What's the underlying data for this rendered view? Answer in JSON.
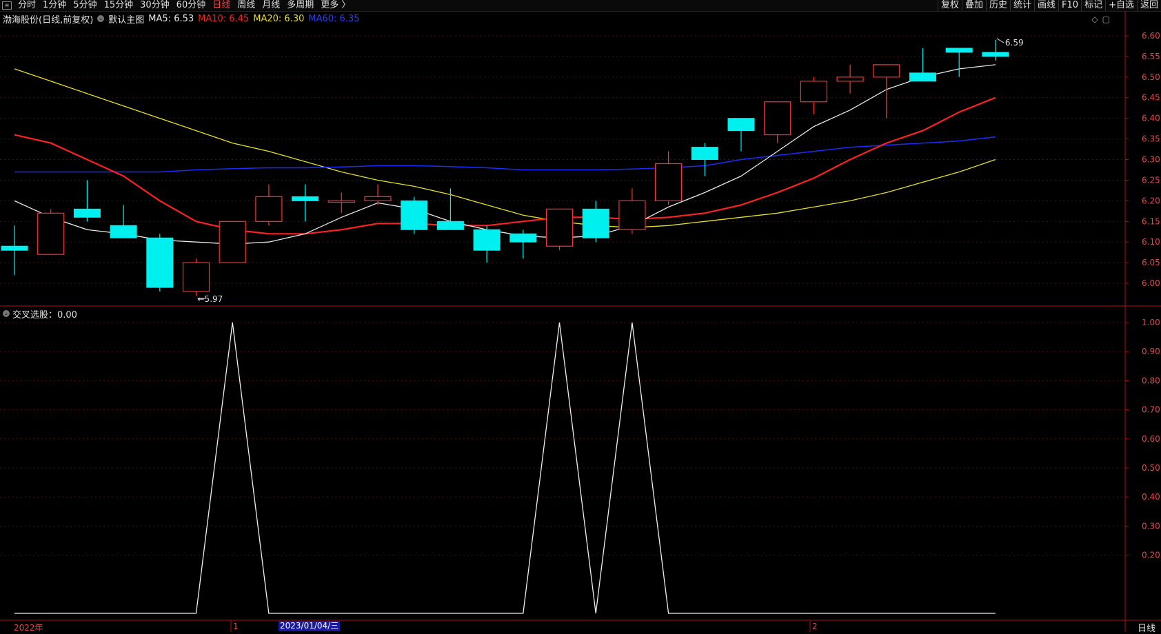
{
  "toolbar": {
    "left_items": [
      "分时",
      "1分钟",
      "5分钟",
      "15分钟",
      "30分钟",
      "60分钟",
      "日线",
      "周线",
      "月线",
      "多周期",
      "更多 〉"
    ],
    "active_item": "日线",
    "right_items": [
      "复权",
      "叠加",
      "历史",
      "统计",
      "画线",
      "F10",
      "标记",
      "+自选",
      "返回"
    ]
  },
  "main_legend": {
    "name": "渤海股份(日线,前复权)",
    "template": "默认主图",
    "ma5": "MA5: 6.53",
    "ma10": "MA10: 6.45",
    "ma20": "MA20: 6.30",
    "ma60": "MA60: 6.35"
  },
  "sub_legend": {
    "indicator": "交叉选股：0.00"
  },
  "bottom": {
    "year_label": "2022年",
    "m1": "1",
    "date": "2023/01/04/三",
    "m2": "2",
    "period": "日线"
  },
  "colors": {
    "up": "#ff3030",
    "down": "#00f0f0",
    "ma5": "#e8e8e8",
    "ma10": "#ff2020",
    "ma20": "#e8e020",
    "ma60": "#1a2cff",
    "axis": "#b01010"
  },
  "chart_data": [
    {
      "type": "candlestick",
      "ylim": [
        5.945,
        6.62
      ],
      "yticks": [
        "6.60",
        "6.55",
        "6.50",
        "6.45",
        "6.40",
        "6.35",
        "6.30",
        "6.25",
        "6.20",
        "6.15",
        "6.10",
        "6.05",
        "6.00"
      ],
      "candles": [
        {
          "o": 6.09,
          "h": 6.14,
          "l": 6.02,
          "c": 6.08
        },
        {
          "o": 6.07,
          "h": 6.18,
          "l": 6.07,
          "c": 6.17
        },
        {
          "o": 6.18,
          "h": 6.25,
          "l": 6.15,
          "c": 6.16
        },
        {
          "o": 6.14,
          "h": 6.19,
          "l": 6.11,
          "c": 6.11
        },
        {
          "o": 6.11,
          "h": 6.12,
          "l": 5.98,
          "c": 5.99
        },
        {
          "o": 5.98,
          "h": 6.06,
          "l": 5.97,
          "c": 6.05
        },
        {
          "o": 6.05,
          "h": 6.15,
          "l": 6.05,
          "c": 6.15
        },
        {
          "o": 6.15,
          "h": 6.24,
          "l": 6.14,
          "c": 6.21
        },
        {
          "o": 6.21,
          "h": 6.24,
          "l": 6.15,
          "c": 6.2
        },
        {
          "o": 6.2,
          "h": 6.22,
          "l": 6.17,
          "c": 6.2
        },
        {
          "o": 6.2,
          "h": 6.24,
          "l": 6.19,
          "c": 6.21
        },
        {
          "o": 6.2,
          "h": 6.21,
          "l": 6.12,
          "c": 6.13
        },
        {
          "o": 6.15,
          "h": 6.23,
          "l": 6.13,
          "c": 6.13
        },
        {
          "o": 6.13,
          "h": 6.14,
          "l": 6.05,
          "c": 6.08
        },
        {
          "o": 6.12,
          "h": 6.13,
          "l": 6.06,
          "c": 6.1
        },
        {
          "o": 6.09,
          "h": 6.18,
          "l": 6.08,
          "c": 6.18
        },
        {
          "o": 6.18,
          "h": 6.2,
          "l": 6.1,
          "c": 6.11
        },
        {
          "o": 6.13,
          "h": 6.23,
          "l": 6.12,
          "c": 6.2
        },
        {
          "o": 6.2,
          "h": 6.32,
          "l": 6.19,
          "c": 6.29
        },
        {
          "o": 6.33,
          "h": 6.34,
          "l": 6.26,
          "c": 6.3
        },
        {
          "o": 6.4,
          "h": 6.4,
          "l": 6.32,
          "c": 6.37
        },
        {
          "o": 6.36,
          "h": 6.44,
          "l": 6.34,
          "c": 6.44
        },
        {
          "o": 6.44,
          "h": 6.5,
          "l": 6.41,
          "c": 6.49
        },
        {
          "o": 6.49,
          "h": 6.53,
          "l": 6.46,
          "c": 6.5
        },
        {
          "o": 6.5,
          "h": 6.53,
          "l": 6.4,
          "c": 6.53
        },
        {
          "o": 6.51,
          "h": 6.57,
          "l": 6.49,
          "c": 6.49
        },
        {
          "o": 6.57,
          "h": 6.57,
          "l": 6.5,
          "c": 6.56
        },
        {
          "o": 6.56,
          "h": 6.59,
          "l": 6.54,
          "c": 6.55
        }
      ],
      "ma5": [
        6.2,
        6.16,
        6.13,
        6.12,
        6.105,
        6.1,
        6.095,
        6.1,
        6.12,
        6.16,
        6.195,
        6.18,
        6.15,
        6.13,
        6.115,
        6.11,
        6.115,
        6.14,
        6.185,
        6.22,
        6.26,
        6.32,
        6.38,
        6.42,
        6.47,
        6.5,
        6.52,
        6.53
      ],
      "ma10": [
        6.36,
        6.34,
        6.3,
        6.26,
        6.2,
        6.15,
        6.13,
        6.12,
        6.12,
        6.13,
        6.145,
        6.145,
        6.14,
        6.14,
        6.15,
        6.16,
        6.16,
        6.155,
        6.16,
        6.17,
        6.19,
        6.22,
        6.255,
        6.3,
        6.34,
        6.37,
        6.415,
        6.45
      ],
      "ma20": [
        6.52,
        6.49,
        6.46,
        6.43,
        6.4,
        6.37,
        6.34,
        6.32,
        6.295,
        6.27,
        6.25,
        6.235,
        6.215,
        6.19,
        6.165,
        6.15,
        6.14,
        6.135,
        6.14,
        6.15,
        6.16,
        6.17,
        6.185,
        6.2,
        6.22,
        6.245,
        6.27,
        6.3
      ],
      "ma60": [
        6.27,
        6.27,
        6.27,
        6.27,
        6.27,
        6.275,
        6.278,
        6.28,
        6.28,
        6.282,
        6.285,
        6.285,
        6.283,
        6.28,
        6.275,
        6.275,
        6.275,
        6.277,
        6.28,
        6.285,
        6.3,
        6.31,
        6.32,
        6.33,
        6.335,
        6.34,
        6.345,
        6.355
      ],
      "annotations": [
        {
          "index": 5,
          "value": 5.97,
          "label": "5.97"
        },
        {
          "index": 27,
          "value": 6.59,
          "label": "6.59"
        }
      ]
    },
    {
      "type": "line",
      "name": "交叉选股",
      "ylim": [
        0,
        1.0
      ],
      "yticks": [
        "1.00",
        "0.90",
        "0.80",
        "0.70",
        "0.60",
        "0.50",
        "0.40",
        "0.30",
        "0.20"
      ],
      "values": [
        0,
        0,
        0,
        0,
        0,
        0,
        1,
        0,
        0,
        0,
        0,
        0,
        0,
        0,
        0,
        1,
        0,
        1,
        0,
        0,
        0,
        0,
        0,
        0,
        0,
        0,
        0,
        0
      ]
    }
  ]
}
